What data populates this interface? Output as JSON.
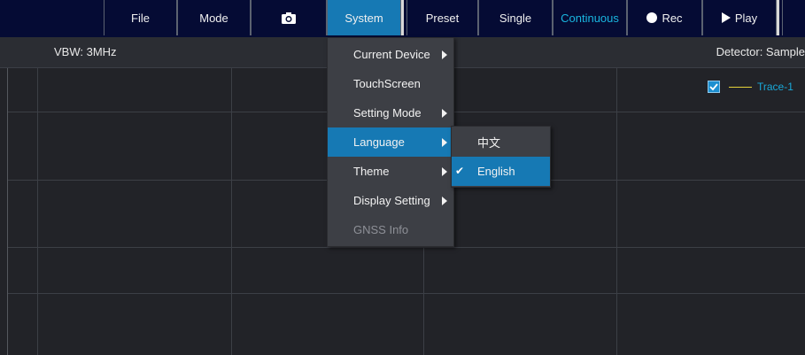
{
  "toolbar": {
    "file": "File",
    "mode": "Mode",
    "camera_icon": "camera-icon",
    "system": "System",
    "preset": "Preset",
    "single": "Single",
    "continuous": "Continuous",
    "rec": "Rec",
    "play": "Play"
  },
  "infobar": {
    "vbw": "VBW: 3MHz",
    "detector": "Detector: Sample"
  },
  "legend": {
    "trace": "Trace-1",
    "checked": true
  },
  "system_menu": {
    "items": [
      {
        "label": "Current Device",
        "submenu": true
      },
      {
        "label": "TouchScreen",
        "submenu": false
      },
      {
        "label": "Setting Mode",
        "submenu": true
      },
      {
        "label": "Language",
        "submenu": true,
        "highlighted": true
      },
      {
        "label": "Theme",
        "submenu": true
      },
      {
        "label": "Display Setting",
        "submenu": true
      },
      {
        "label": "GNSS Info",
        "submenu": false,
        "disabled": true
      }
    ]
  },
  "language_menu": {
    "items": [
      {
        "label": "中文",
        "checked": false
      },
      {
        "label": "English",
        "checked": true
      }
    ]
  },
  "colors": {
    "toolbar_bg": "#050b34",
    "accent": "#1679b4",
    "cyan_text": "#19b6e0",
    "trace_color": "#e6d23a"
  }
}
